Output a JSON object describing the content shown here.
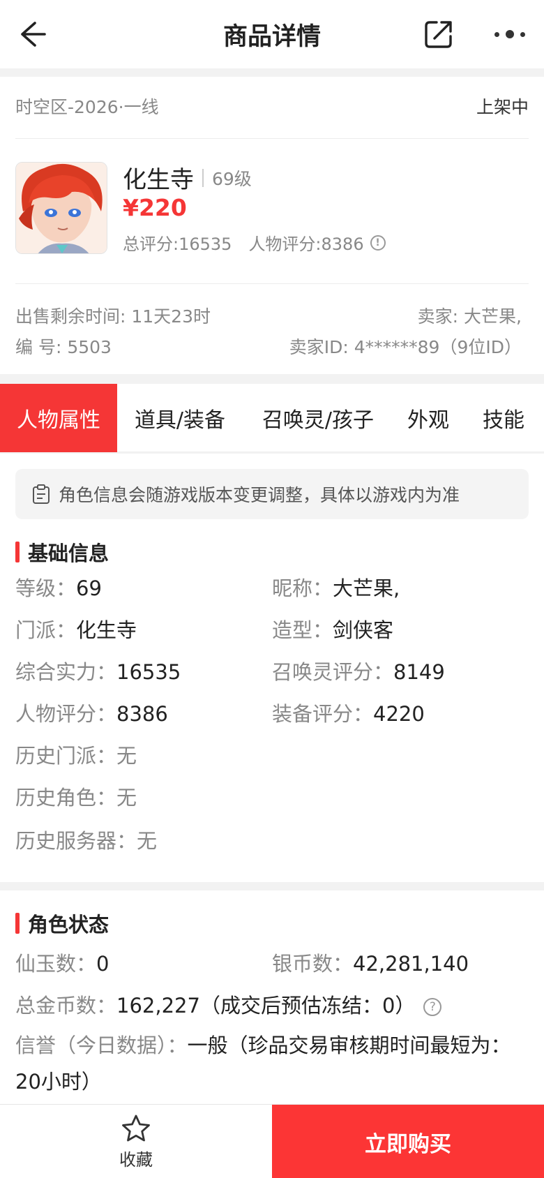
{
  "header": {
    "title": "商品详情"
  },
  "listing": {
    "server": "时空区-2026·一线",
    "status": "上架中",
    "character_name": "化生寺",
    "level": "69级",
    "price": "¥220",
    "total_score": "总评分:16535",
    "char_score": "人物评分:8386",
    "remaining_time": "出售剩余时间: 11天23时",
    "seller": "卖家: 大芒果,",
    "number": "编 号: 5503",
    "seller_id": "卖家ID: 4******89（9位ID）"
  },
  "tabs": [
    "人物属性",
    "道具/装备",
    "召唤灵/孩子",
    "外观",
    "技能"
  ],
  "active_tab": 0,
  "notice": "角色信息会随游戏版本变更调整，具体以游戏内为准",
  "basic_info": {
    "title": "基础信息",
    "level": {
      "k": "等级：",
      "v": "69"
    },
    "nickname": {
      "k": "昵称：",
      "v": "大芒果,"
    },
    "school": {
      "k": "门派：",
      "v": "化生寺"
    },
    "model": {
      "k": "造型：",
      "v": "剑侠客"
    },
    "power": {
      "k": "综合实力：",
      "v": "16535"
    },
    "summon_score": {
      "k": "召唤灵评分：",
      "v": "8149"
    },
    "char_score": {
      "k": "人物评分：",
      "v": "8386"
    },
    "equip_score": {
      "k": "装备评分：",
      "v": "4220"
    },
    "hist_school": {
      "k": "历史门派：",
      "v": "无"
    },
    "hist_role": {
      "k": "历史角色：",
      "v": "无"
    },
    "hist_server": {
      "k": "历史服务器：",
      "v": "无"
    }
  },
  "role_status": {
    "title": "角色状态",
    "jade": {
      "k": "仙玉数：",
      "v": "0"
    },
    "silver": {
      "k": "银币数：",
      "v": "42,281,140"
    },
    "gold": {
      "k": "总金币数：",
      "v": "162,227（成交后预估冻结：0）"
    },
    "credit": {
      "k": "信誉（今日数据）：",
      "v": "一般（珍品交易审核期时间最短为：20小时）"
    }
  },
  "bottom": {
    "favorite": "收藏",
    "buy": "立即购买"
  },
  "colors": {
    "accent": "#f53636",
    "buy_button": "#fc3535"
  }
}
